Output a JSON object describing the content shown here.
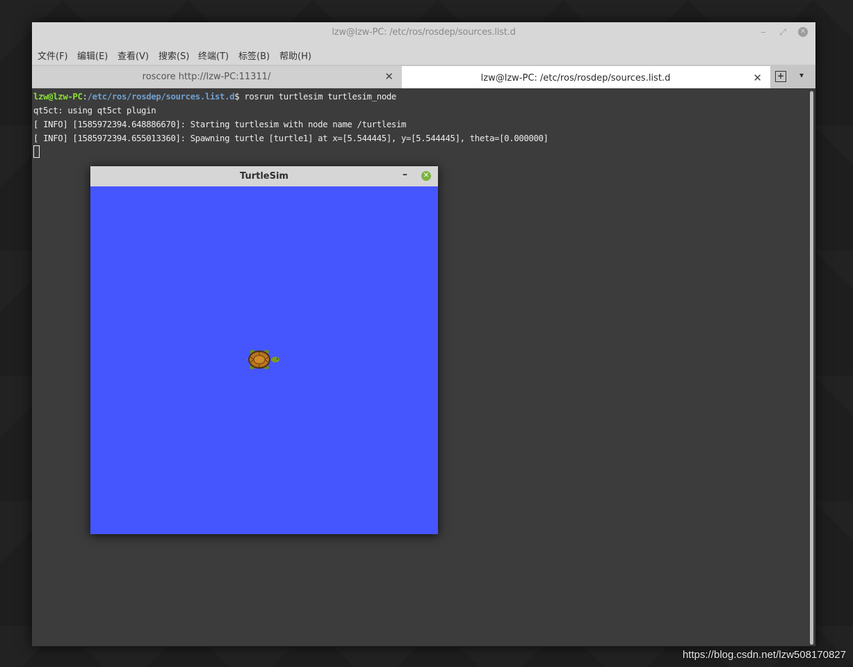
{
  "terminal": {
    "title": "lzw@lzw-PC: /etc/ros/rosdep/sources.list.d",
    "window_controls": {
      "minimize": "‒",
      "maximize": "⤢",
      "close": "✕"
    },
    "menu": [
      "文件(F)",
      "编辑(E)",
      "查看(V)",
      "搜索(S)",
      "终端(T)",
      "标签(B)",
      "帮助(H)"
    ],
    "tabs": [
      {
        "label": "roscore http://lzw-PC:11311/",
        "close": "✕"
      },
      {
        "label": "lzw@lzw-PC: /etc/ros/rosdep/sources.list.d",
        "close": "✕"
      }
    ],
    "tab_new_icon": "+",
    "tab_menu_icon": "▾",
    "prompt": {
      "user_host": "lzw@lzw-PC",
      "sep": ":",
      "path": "/etc/ros/rosdep/sources.list.d",
      "dollar": "$ ",
      "command": "rosrun turtlesim turtlesim_node"
    },
    "output": [
      "qt5ct: using qt5ct plugin",
      "[ INFO] [1585972394.648886670]: Starting turtlesim with node name /turtlesim",
      "[ INFO] [1585972394.655013360]: Spawning turtle [turtle1] at x=[5.544445], y=[5.544445], theta=[0.000000]"
    ]
  },
  "turtlesim": {
    "title": "TurtleSim",
    "minimize": "–",
    "close": "✕",
    "background_color": "#4556ff"
  },
  "watermark": "https://blog.csdn.net/lzw508170827"
}
